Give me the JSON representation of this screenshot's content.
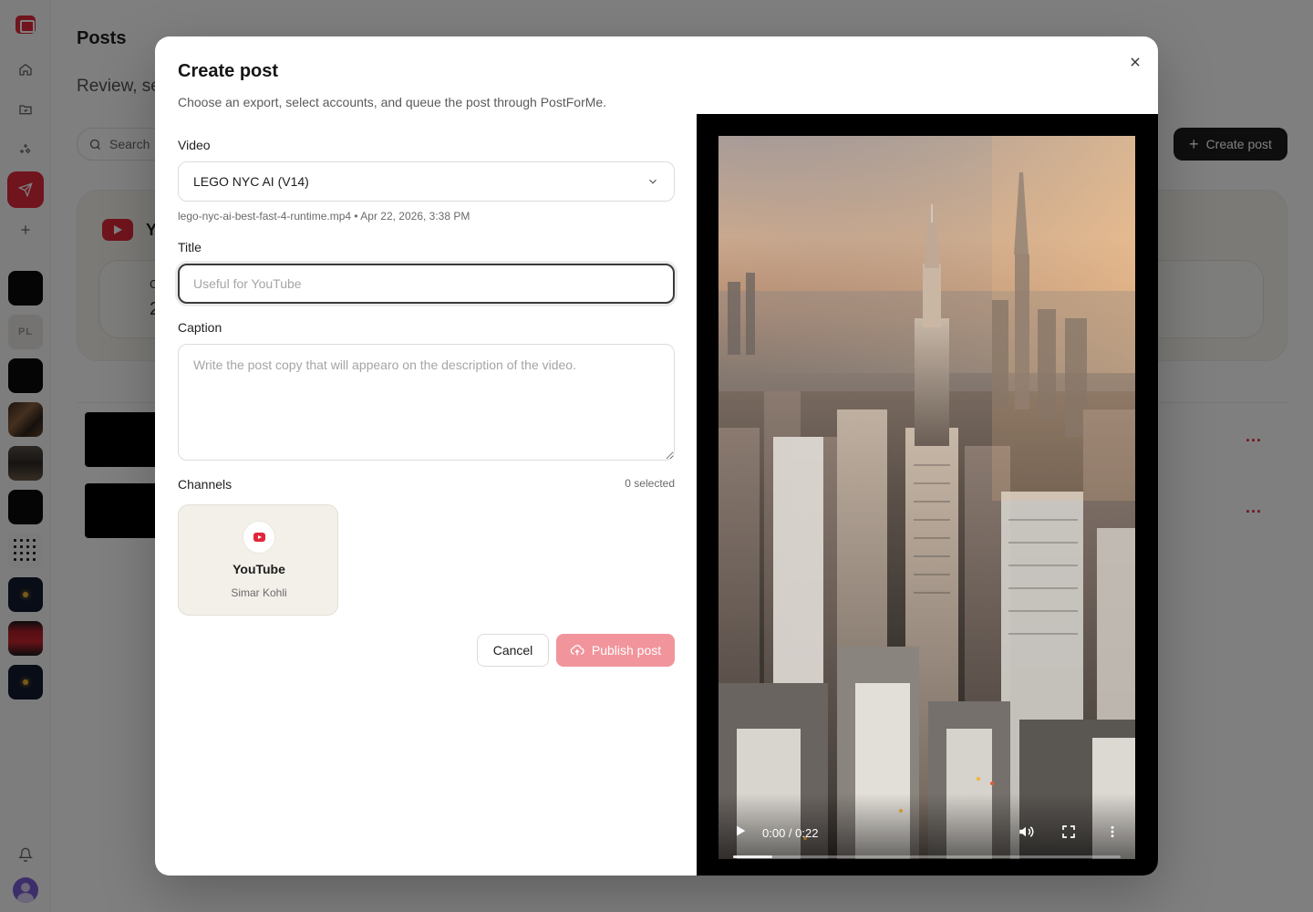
{
  "background": {
    "title": "Posts",
    "subtitle": "Review, se",
    "search_label": "Search",
    "create_button_label": "Create post",
    "card_letter": "Y",
    "card_inner_label": "C",
    "card_inner_value": "2",
    "row_menu": "..."
  },
  "sidebar": {
    "thumb_pl_label": "PL"
  },
  "modal": {
    "title": "Create post",
    "description": "Choose an export, select accounts, and queue the post through PostForMe.",
    "video": {
      "label": "Video",
      "selected": "LEGO NYC AI (V14)",
      "meta": "lego-nyc-ai-best-fast-4-runtime.mp4 • Apr 22, 2026, 3:38 PM"
    },
    "title_field": {
      "label": "Title",
      "value": "",
      "placeholder": "Useful for YouTube"
    },
    "caption_field": {
      "label": "Caption",
      "value": "",
      "placeholder": "Write the post copy that will appearo on the description of the video."
    },
    "channels": {
      "label": "Channels",
      "selected_count": "0 selected",
      "items": [
        {
          "icon": "youtube-icon",
          "name": "YouTube",
          "account": "Simar Kohli",
          "color": "#e0283a"
        }
      ]
    },
    "cancel_label": "Cancel",
    "publish_label": "Publish post",
    "preview": {
      "time": "0:00 / 0:22",
      "buffered_fraction": 0.1
    }
  },
  "colors": {
    "accent": "#e0283a",
    "publish_disabled": "#f2949c",
    "card_background": "#f3f0ea"
  }
}
